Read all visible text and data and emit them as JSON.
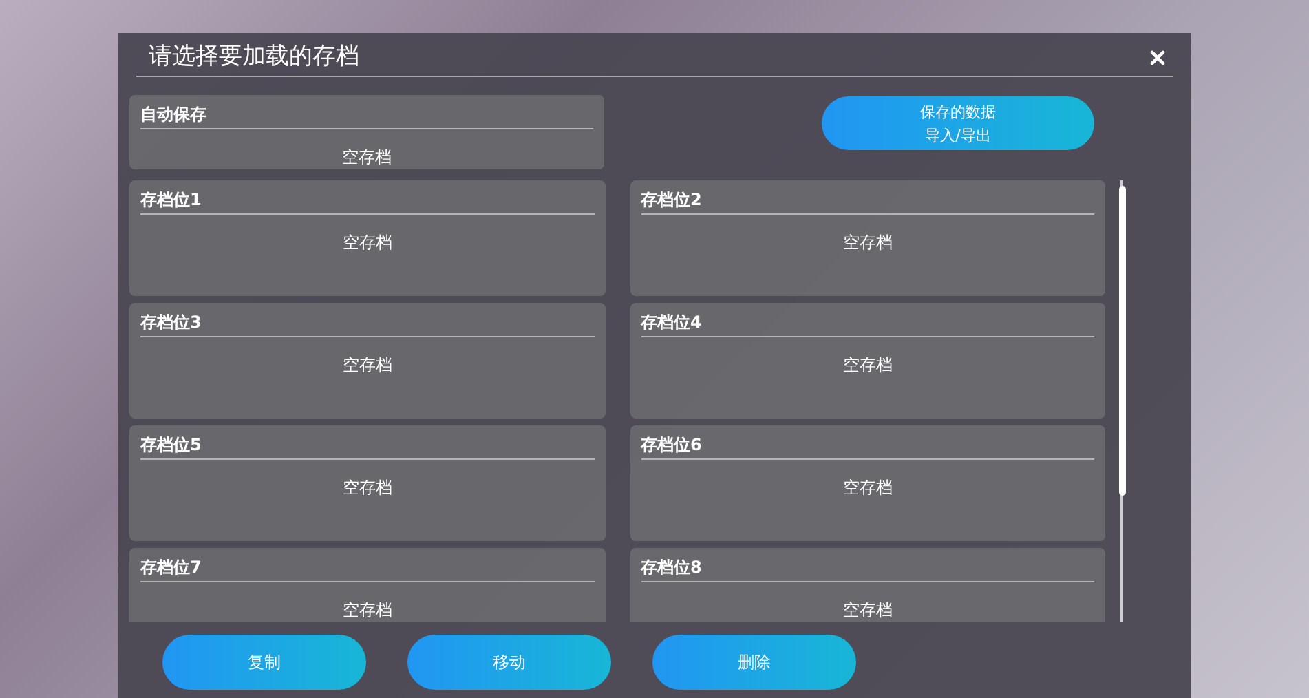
{
  "dialog": {
    "title": "请选择要加载的存档"
  },
  "autosave": {
    "label": "自动保存",
    "status": "空存档"
  },
  "data_button": {
    "lines": [
      "保存的数据",
      "导入/导出"
    ]
  },
  "slots": [
    {
      "label": "存档位1",
      "status": "空存档"
    },
    {
      "label": "存档位2",
      "status": "空存档"
    },
    {
      "label": "存档位3",
      "status": "空存档"
    },
    {
      "label": "存档位4",
      "status": "空存档"
    },
    {
      "label": "存档位5",
      "status": "空存档"
    },
    {
      "label": "存档位6",
      "status": "空存档"
    },
    {
      "label": "存档位7",
      "status": "空存档"
    },
    {
      "label": "存档位8",
      "status": "空存档"
    }
  ],
  "actions": [
    "复制",
    "移动",
    "删除"
  ]
}
